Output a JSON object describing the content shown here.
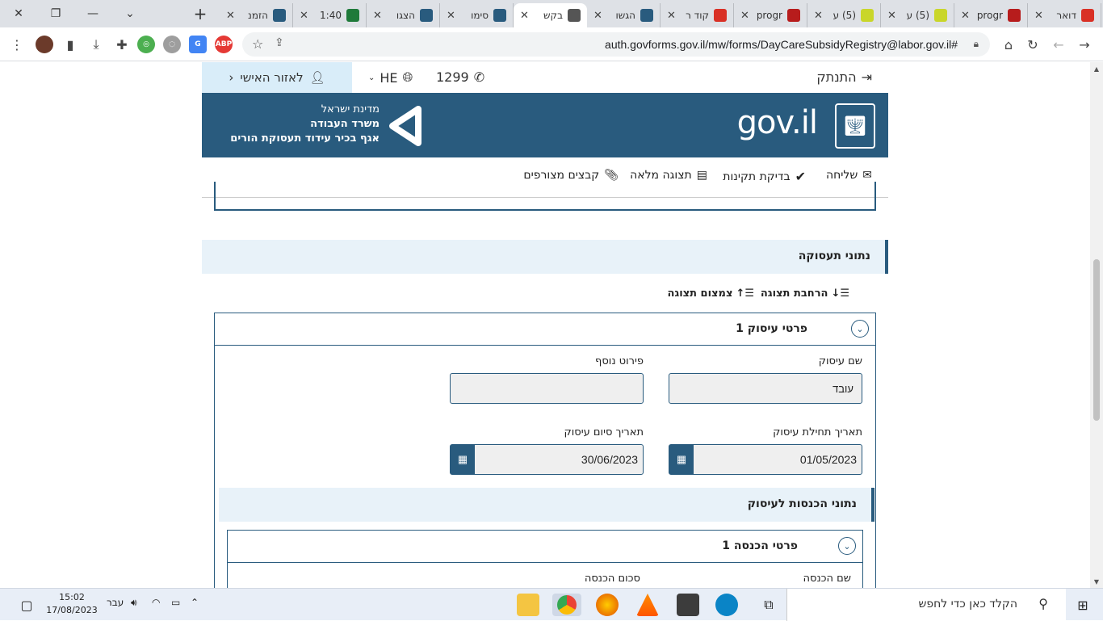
{
  "browser": {
    "tabs": [
      {
        "title": "דואר",
        "color": "#d93025",
        "active": false
      },
      {
        "title": "progr",
        "color": "#b71c1c",
        "active": false
      },
      {
        "title": "(5) ע",
        "color": "#c9d62a",
        "active": false
      },
      {
        "title": "(5) ע",
        "color": "#c9d62a",
        "active": false
      },
      {
        "title": "progr",
        "color": "#b71c1c",
        "active": false
      },
      {
        "title": "קוד ר",
        "color": "#d93025",
        "active": false
      },
      {
        "title": "הגשו",
        "color": "#295b7e",
        "active": false
      },
      {
        "title": "בקש",
        "color": "#555555",
        "active": true
      },
      {
        "title": "סימו",
        "color": "#295b7e",
        "active": false
      },
      {
        "title": "הצגו",
        "color": "#295b7e",
        "active": false
      },
      {
        "title": "1:40",
        "color": "#1f7a3a",
        "active": false
      },
      {
        "title": "הזמנ",
        "color": "#295b7e",
        "active": false
      }
    ],
    "new_tab": "+",
    "close_glyph": "✕",
    "url": "auth.govforms.gov.il/mw/forms/DayCareSubsidyRegistry@labor.gov.il#",
    "window_controls": {
      "minimize": "—",
      "restore": "❐",
      "close": "✕",
      "dropdown": "⌄"
    }
  },
  "site": {
    "logout": "התנתק",
    "phone": "1299",
    "lang": "HE",
    "personal_area": "לאזור האישי",
    "gov_logo": "gov.il",
    "ministry": {
      "line1": "מדינת ישראל",
      "line2": "משרד העבודה",
      "line3": "אגף בכיר עידוד תעסוקת הורים"
    },
    "actions": {
      "send": "שליחה",
      "validate": "בדיקת תקינות",
      "full_view": "תצוגה מלאה",
      "attachments": "קבצים מצורפים"
    }
  },
  "form": {
    "section_title": "נתוני תעסוקה",
    "expand_view": "הרחבת תצוגה",
    "collapse_view": "צמצום תצוגה",
    "employment_panel_title": "פרטי עיסוק 1",
    "business_name_label": "שם עיסוק",
    "business_name_value": "עובד",
    "extra_detail_label": "פירוט נוסף",
    "extra_detail_value": "",
    "start_date_label": "תאריך תחילת עיסוק",
    "start_date_value": "01/05/2023",
    "end_date_label": "תאריך סיום עיסוק",
    "end_date_value": "30/06/2023",
    "income_section_title": "נתוני הכנסות לעיסוק",
    "income_panel_title": "פרטי הכנסה 1",
    "income_name_label": "שם הכנסה",
    "income_amount_label": "סכום הכנסה"
  },
  "taskbar": {
    "search_placeholder": "הקלד כאן כדי לחפש",
    "time": "15:02",
    "date": "17/08/2023",
    "lang": "עבר"
  },
  "colors": {
    "brand": "#295b7e",
    "light_bg": "#e8f2f9"
  }
}
